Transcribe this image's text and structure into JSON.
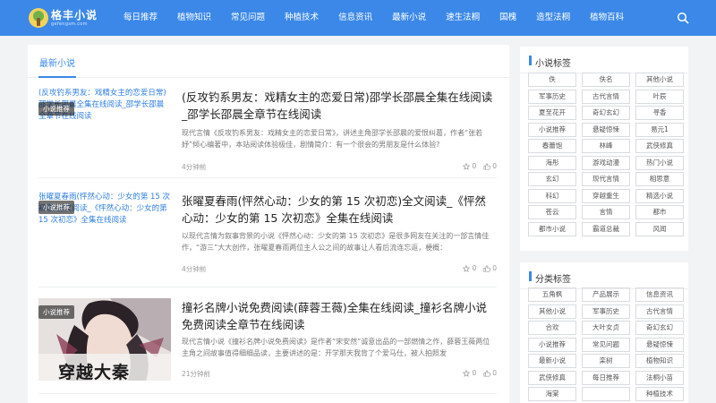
{
  "header": {
    "logo_title": "格丰小说",
    "logo_sub": "gefengsm.com",
    "nav": [
      "每日推荐",
      "植物知识",
      "常见问题",
      "种植技术",
      "信息资讯",
      "最新小说",
      "速生法桐",
      "国槐",
      "造型法桐",
      "植物百科"
    ]
  },
  "main": {
    "title": "最新小说",
    "posts": [
      {
        "thumb_text": "(反攻钓系男友：戏精女主的恋爱日常)邵学长邵晨全集在线阅读_邵学长邵晨全章节在线阅读",
        "category": "小说推荐",
        "title": "(反攻钓系男友：戏精女主的恋爱日常)邵学长邵晨全集在线阅读_邵学长邵晨全章节在线阅读",
        "desc": "现代言情《反攻钓系男友：戏精女主的恋爱日常》，讲述主角邵学长邵晨的爱恨纠葛，作者“张若妤”倾心编著中，本站阅读体验极佳，剧情简介：有一个很会的男朋友是什么体验?",
        "time": "4分钟前",
        "stars": "0",
        "likes": "0"
      },
      {
        "thumb_text": "张曜夏春雨(怦然心动：少女的第 15 次初恋)全文阅读_《怦然心动：少女的第 15 次初恋》全集在线阅读",
        "category": "小说推荐",
        "title": "张曜夏春雨(怦然心动：少女的第 15 次初恋)全文阅读_《怦然心动：少女的第 15 次初恋》全集在线阅读",
        "desc": "以现代言情为叙事背景的小说《怦然心动：少女的第 15 次初恋》是很多网友在关注的一部言情佳作，“游三”大大创作，张曜夏春雨两位主人公之间的故事让人看后流连忘返，梗概：",
        "time": "4分钟前",
        "stars": "0",
        "likes": "0"
      },
      {
        "category": "小说推荐",
        "image_caption": "穿越大秦",
        "title": "撞衫名牌小说免费阅读(薛蓉王薇)全集在线阅读_撞衫名牌小说免费阅读全章节在线阅读",
        "desc": "现代言情小说《撞衫名牌小说免费阅读》是作者“宋安然”诚意出品的一部燃情之作，薛蓉王薇两位主角之间故事值得细细品读，主要讲述的是：开学那天我背了个爱马仕，被人拍照发",
        "time": "21分钟前",
        "stars": "0",
        "likes": "0"
      }
    ]
  },
  "sidebar": {
    "novel_tags_title": "小说标签",
    "novel_tags": [
      "佚",
      "佚名",
      "其他小说",
      "军事历史",
      "古代言情",
      "叶辰",
      "夏至花开",
      "奇幻玄幻",
      "寻香",
      "小说推荐",
      "悬疑惊悚",
      "易元1",
      "春蕾饱",
      "林峰",
      "武侠修真",
      "海彤",
      "游戏动漫",
      "热门小说",
      "玄幻",
      "现代言情",
      "相思意",
      "科幻",
      "穿越重生",
      "精选小说",
      "苍云",
      "言情",
      "都市",
      "都市小说",
      "霸道总裁",
      "风闻"
    ],
    "category_tags_title": "分类标签",
    "category_tags": [
      "五角枫",
      "产品展示",
      "信息资讯",
      "其他小说",
      "军事历史",
      "古代言情",
      "合欢",
      "大叶女贞",
      "奇幻玄幻",
      "小说推荐",
      "常见问题",
      "悬疑惊悚",
      "最新小说",
      "栾树",
      "植物知识",
      "武侠修真",
      "每日推荐",
      "法桐小苗",
      "海棠",
      "",
      "种植技术"
    ]
  },
  "colors": {
    "brand": "#3b88e8",
    "link": "#2f7fe0"
  }
}
